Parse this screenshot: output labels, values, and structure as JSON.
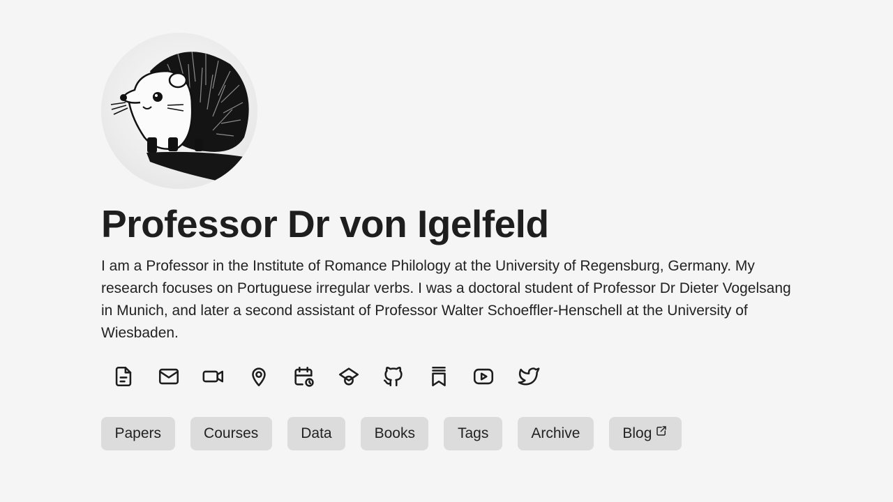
{
  "profile": {
    "name": "Professor Dr von Igelfeld",
    "avatar_alt": "hedgehog-illustration",
    "bio": "I am a Professor in the Institute of Romance Philology at the University of Regensburg, Germany. My research focuses on Portuguese irregular verbs. I was a doctoral student of Professor Dr Dieter Vogelsang in Munich, and later a second assistant of Professor Walter Schoeffler-Henschell at the University of Wiesbaden."
  },
  "social_links": [
    {
      "icon": "document-icon"
    },
    {
      "icon": "mail-icon"
    },
    {
      "icon": "video-camera-icon"
    },
    {
      "icon": "map-pin-icon"
    },
    {
      "icon": "calendar-clock-icon"
    },
    {
      "icon": "graduation-cap-icon"
    },
    {
      "icon": "github-icon"
    },
    {
      "icon": "bookmark-stack-icon"
    },
    {
      "icon": "youtube-icon"
    },
    {
      "icon": "twitter-icon"
    }
  ],
  "nav": {
    "items": [
      {
        "label": "Papers"
      },
      {
        "label": "Courses"
      },
      {
        "label": "Data"
      },
      {
        "label": "Books"
      },
      {
        "label": "Tags"
      },
      {
        "label": "Archive"
      },
      {
        "label": "Blog",
        "external": true
      }
    ]
  },
  "colors": {
    "background": "#f5f5f5",
    "button_bg": "#dcdcdc",
    "text": "#1f1f1f"
  }
}
